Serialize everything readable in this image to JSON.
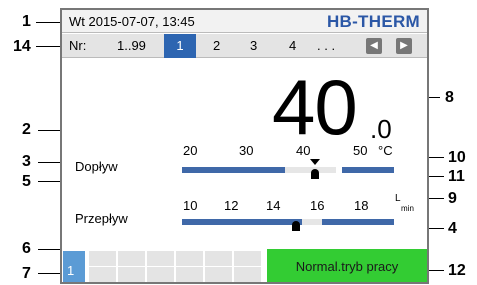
{
  "status_bar": {
    "datetime": "Wt 2015-07-07, 13:45",
    "logo": "HB-THERM"
  },
  "nav": {
    "prefix": "Nr:",
    "range": "1..99",
    "pages": [
      "1",
      "2",
      "3",
      "4"
    ],
    "active_page": "1",
    "ellipsis": ". . .",
    "prev_icon": "skip-back-icon",
    "next_icon": "skip-forward-icon"
  },
  "main": {
    "temperature": "40",
    "temperature_decimal": ".0",
    "supply": {
      "label": "Dopływ",
      "ticks": [
        "20",
        "30",
        "40",
        "50"
      ],
      "unit": "°C",
      "setpoint": 40,
      "actual": 40
    },
    "flow": {
      "label": "Przepływ",
      "ticks": [
        "10",
        "12",
        "14",
        "16",
        "18"
      ],
      "unit_top": "L",
      "unit_bottom": "min",
      "actual": 14.5
    }
  },
  "bottom": {
    "page_indicator": "1",
    "mode_text": "Normal.tryb pracy",
    "mode_color": "#33cc33"
  },
  "callouts": [
    "1",
    "14",
    "2",
    "3",
    "5",
    "6",
    "7",
    "8",
    "10",
    "11",
    "9",
    "4",
    "12"
  ],
  "colors": {
    "accent_blue": "#2d65b1",
    "bar_blue": "#3f68a8",
    "logo_blue": "#2b57a6",
    "status_green": "#33cc33"
  }
}
